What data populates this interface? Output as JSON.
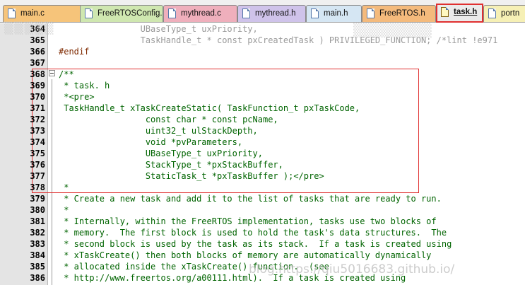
{
  "tabs": [
    {
      "label": "main.c",
      "color": "#f6c47a",
      "active": false
    },
    {
      "label": "FreeRTOSConfig.h",
      "color": "#cfe7b0",
      "active": false
    },
    {
      "label": "mythread.c",
      "color": "#efafbc",
      "active": false
    },
    {
      "label": "mythread.h",
      "color": "#cfc3ea",
      "active": false
    },
    {
      "label": "main.h",
      "color": "#d5e6f3",
      "active": false
    },
    {
      "label": "FreeRTOS.h",
      "color": "#f4ba7c",
      "active": false
    },
    {
      "label": "task.h",
      "color": "#ebebeb",
      "active": true
    },
    {
      "label": "portn",
      "color": "#f6f0b5",
      "active": false
    }
  ],
  "lines": [
    {
      "n": "364",
      "text": "                UBaseType_t uxPriority,",
      "kind": "dim"
    },
    {
      "n": "365",
      "text": "                TaskHandle_t * const pxCreatedTask ) PRIVILEGED_FUNCTION; /*lint !e971",
      "kind": "dim"
    },
    {
      "n": "366",
      "text": "#endif",
      "kind": "pre"
    },
    {
      "n": "367",
      "text": "",
      "kind": "comment"
    },
    {
      "n": "368",
      "text": "/**",
      "kind": "comment"
    },
    {
      "n": "369",
      "text": " * task. h",
      "kind": "comment"
    },
    {
      "n": "370",
      "text": " *<pre>",
      "kind": "comment"
    },
    {
      "n": "371",
      "text": " TaskHandle_t xTaskCreateStatic( TaskFunction_t pxTaskCode,",
      "kind": "comment"
    },
    {
      "n": "372",
      "text": "                 const char * const pcName,",
      "kind": "comment"
    },
    {
      "n": "373",
      "text": "                 uint32_t ulStackDepth,",
      "kind": "comment"
    },
    {
      "n": "374",
      "text": "                 void *pvParameters,",
      "kind": "comment"
    },
    {
      "n": "375",
      "text": "                 UBaseType_t uxPriority,",
      "kind": "comment"
    },
    {
      "n": "376",
      "text": "                 StackType_t *pxStackBuffer,",
      "kind": "comment"
    },
    {
      "n": "377",
      "text": "                 StaticTask_t *pxTaskBuffer );</pre>",
      "kind": "comment"
    },
    {
      "n": "378",
      "text": " *",
      "kind": "comment"
    },
    {
      "n": "379",
      "text": " * Create a new task and add it to the list of tasks that are ready to run.",
      "kind": "comment"
    },
    {
      "n": "380",
      "text": " *",
      "kind": "comment"
    },
    {
      "n": "381",
      "text": " * Internally, within the FreeRTOS implementation, tasks use two blocks of",
      "kind": "comment"
    },
    {
      "n": "382",
      "text": " * memory.  The first block is used to hold the task's data structures.  The",
      "kind": "comment"
    },
    {
      "n": "383",
      "text": " * second block is used by the task as its stack.  If a task is created using",
      "kind": "comment"
    },
    {
      "n": "384",
      "text": " * xTaskCreate() then both blocks of memory are automatically dynamically",
      "kind": "comment"
    },
    {
      "n": "385",
      "text": " * allocated inside the xTaskCreate() function.  (see",
      "kind": "comment"
    },
    {
      "n": "386",
      "text": " * http://www.freertos.org/a00111.html).  If a task is created using",
      "kind": "comment"
    }
  ],
  "watermark": "blog.https://qiu5016683.github.io/"
}
